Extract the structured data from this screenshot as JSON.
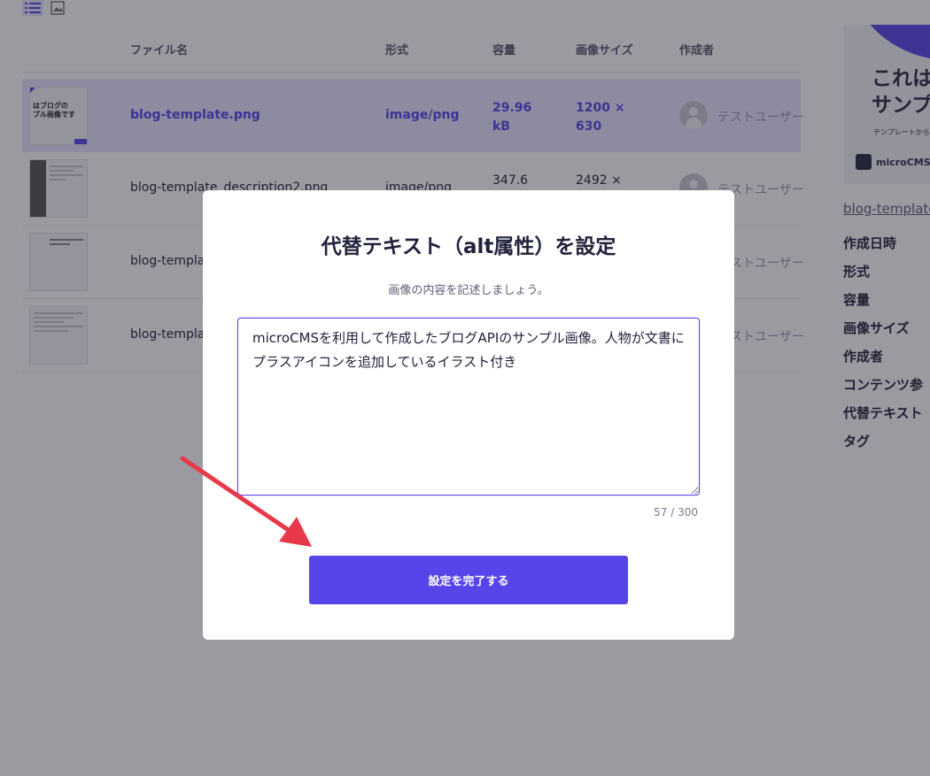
{
  "table": {
    "headers": {
      "filename": "ファイル名",
      "format": "形式",
      "size": "容量",
      "image_size": "画像サイズ",
      "creator": "作成者"
    },
    "rows": [
      {
        "filename": "blog-template.png",
        "format": "image/png",
        "size_line1": "29.96",
        "size_line2": "kB",
        "dims_line1": "1200 ×",
        "dims_line2": "630",
        "creator": "テストユーザー",
        "thumb_text": "はブログの\nプル画像です",
        "selected": true
      },
      {
        "filename": "blog-template_description2.png",
        "format": "image/png",
        "size_line1": "347.6",
        "size_line2": "",
        "dims_line1": "2492 ×",
        "dims_line2": "",
        "creator": "テストユーザー"
      },
      {
        "filename": "blog-templat",
        "creator": "テストユーザー"
      },
      {
        "filename": "blog-templat",
        "creator": "テストユーザー"
      }
    ]
  },
  "right_panel": {
    "banner_line1": "これは",
    "banner_line2": "サンプ",
    "banner_small": "テンプレートから",
    "banner_logo": "microCMS",
    "filename": "blog-template",
    "meta": [
      "作成日時",
      "形式",
      "容量",
      "画像サイズ",
      "作成者",
      "コンテンツ参",
      "代替テキスト",
      "タグ"
    ]
  },
  "modal": {
    "title": "代替テキスト（alt属性）を設定",
    "description": "画像の内容を記述しましょう。",
    "alt_text": "microCMSを利用して作成したブログAPIのサンプル画像。人物が文書にプラスアイコンを追加しているイラスト付き",
    "counter": "57 / 300",
    "submit_label": "設定を完了する"
  },
  "colors": {
    "accent": "#5845ea",
    "annotation_arrow": "#e8394a",
    "selected_row": "#e7e4ff"
  },
  "icons": {
    "view_list": "list-view-icon",
    "view_grid": "image-view-icon",
    "avatar": "user-avatar-icon"
  }
}
